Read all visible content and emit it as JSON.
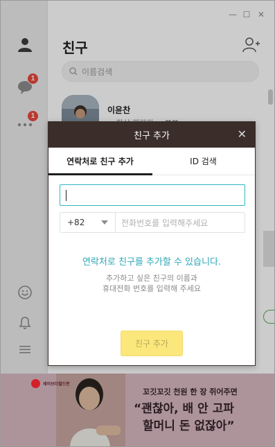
{
  "window": {
    "controls": {
      "minimize": "—",
      "maximize": "☐",
      "close": "✕"
    }
  },
  "rail": {
    "chats_badge": "1",
    "more_badge": "1"
  },
  "main": {
    "title": "친구",
    "search_placeholder": "이름검색",
    "friend": {
      "name": "이윤찬",
      "status": "~ 항상 행복하 ~ ♥♥"
    }
  },
  "modal": {
    "title": "친구 추가",
    "close": "✕",
    "tabs": [
      {
        "label": "연락처로 친구 추가",
        "active": true
      },
      {
        "label": "ID 검색",
        "active": false
      }
    ],
    "name_value": "",
    "country_code": "+82",
    "phone_placeholder": "전화번호를 입력해주세요",
    "headline": "연락처로 친구를 추가할 수 있습니다.",
    "description_line1": "추가하고 싶은 친구의 이름과",
    "description_line2": "휴대전화 번호를 입력해 주세요",
    "submit_label": "친구 추가"
  },
  "ad": {
    "logo_text": "세이브더칠드런",
    "line1": "꼬깃꼬깃 천원 한 장 쥐어주면",
    "line2": "“괜찮아, 배 안 고파",
    "line3": "할머니 돈 없잖아”"
  },
  "colors": {
    "modal_header": "#3b2e2a",
    "accent_teal": "#2ba7b8",
    "button_yellow": "#fbe77c",
    "badge_red": "#e9483b"
  }
}
